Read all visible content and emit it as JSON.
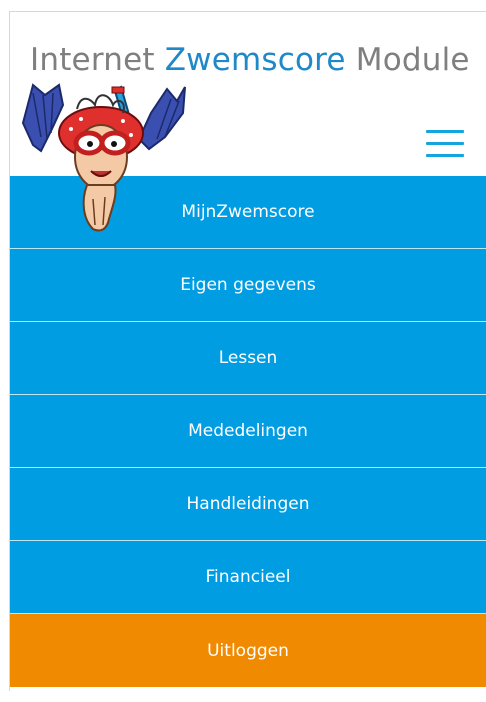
{
  "brand": {
    "part1": "Internet ",
    "part2": "Zwemscore",
    "part3": " Module"
  },
  "menu": {
    "items": [
      {
        "label": "MijnZwemscore"
      },
      {
        "label": "Eigen gegevens"
      },
      {
        "label": "Lessen"
      },
      {
        "label": "Mededelingen"
      },
      {
        "label": "Handleidingen"
      },
      {
        "label": "Financieel"
      }
    ],
    "logout_label": "Uitloggen"
  },
  "colors": {
    "menu_blue": "#009de3",
    "logout_orange": "#f08a00",
    "brand_gray": "#7f7f7f",
    "brand_accent": "#1e88c8"
  },
  "icons": {
    "hamburger": "hamburger-menu-icon",
    "mascot": "diver-mascot-logo"
  }
}
